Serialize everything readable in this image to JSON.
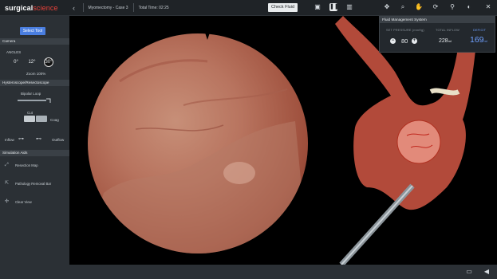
{
  "app": {
    "brand_main": "surgical",
    "brand_accent": "science",
    "case": "Myomectomy - Case 3",
    "total_time": "Total Time: 02:25"
  },
  "toolbar": {
    "check_fluid": "Check Fluid",
    "icons": [
      "view-icon",
      "pause-icon",
      "camera-icon",
      "move-icon",
      "search-icon",
      "hand-icon",
      "rotate-icon",
      "tool-icon",
      "night-icon",
      "close-icon"
    ]
  },
  "sidebar": {
    "select_tool": "Select Tool",
    "camera_header": "Camera",
    "angles_label": "ANGLES",
    "angles": [
      "0°",
      "12°",
      "30°"
    ],
    "zoom": "Zoom 100%",
    "hys_header": "Hysteroscope/Resectoscope",
    "tools": {
      "bipolar": "Bipolar Loop",
      "cut": "Cut",
      "coag": "Coag",
      "inflow": "Inflow",
      "outflow": "Outflow"
    },
    "aids_header": "Simulation Aids",
    "aids": [
      "Resection Map",
      "Pathology Removal Bar",
      "Clear View"
    ]
  },
  "fluid": {
    "title": "Fluid Management System",
    "pressure_label": "SET PRESSURE (mmHg)",
    "pressure": "80",
    "inflow_label": "TOTAL INFLOW",
    "inflow": "228",
    "inflow_unit": "ml",
    "deficit_label": "DEFICIT",
    "deficit": "169",
    "deficit_unit": "ml"
  },
  "colors": {
    "accent": "#4a7ee0",
    "deficit": "#6fa0ff",
    "brand_red": "#e8413a"
  }
}
